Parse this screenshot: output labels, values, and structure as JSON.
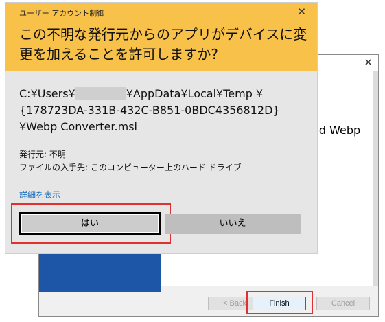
{
  "installer": {
    "visible_text": "ed Webp",
    "buttons": {
      "back": "< Back",
      "finish": "Finish",
      "cancel": "Cancel"
    },
    "close_symbol": "✕"
  },
  "uac": {
    "title": "ユーザー アカウント制御",
    "close_symbol": "✕",
    "question": "この不明な発行元からのアプリがデバイスに変更を加えることを許可しますか?",
    "path_prefix": "C:¥Users¥",
    "path_suffix": "¥AppData¥Local¥Temp ¥{178723DA-331B-432C-B851-0BDC4356812D}¥Webp Converter.msi",
    "publisher": "発行元: 不明",
    "origin": "ファイルの入手先: このコンピューター上のハード ドライブ",
    "details_link": "詳細を表示",
    "yes_label": "はい",
    "no_label": "いいえ"
  },
  "colors": {
    "header": "#f8c14a",
    "installer_side": "#1d56a6",
    "highlight": "#e03030",
    "link": "#1a6fc0"
  }
}
